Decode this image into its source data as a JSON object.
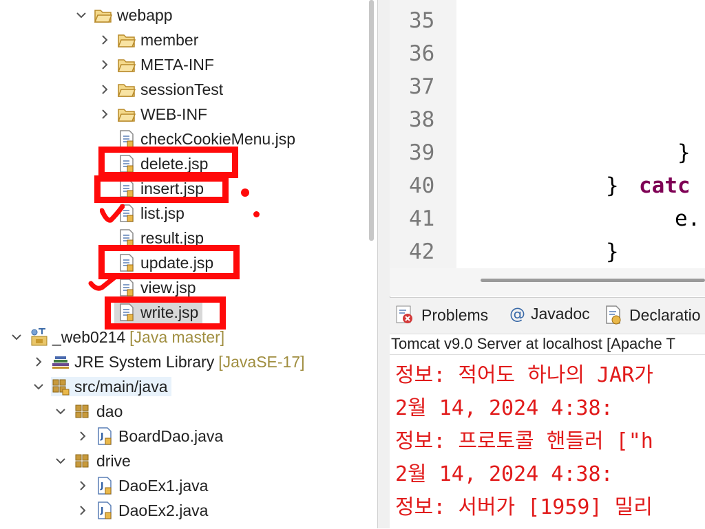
{
  "explorer": {
    "items": [
      {
        "label": "webapp",
        "kind": "folder",
        "expanded": true
      },
      {
        "label": "member",
        "kind": "folder",
        "expanded": false
      },
      {
        "label": "META-INF",
        "kind": "folder",
        "expanded": false
      },
      {
        "label": "sessionTest",
        "kind": "folder",
        "expanded": false
      },
      {
        "label": "WEB-INF",
        "kind": "folder",
        "expanded": false
      },
      {
        "label": "checkCookieMenu.jsp",
        "kind": "jsp"
      },
      {
        "label": "delete.jsp",
        "kind": "jsp"
      },
      {
        "label": "insert.jsp",
        "kind": "jsp"
      },
      {
        "label": "list.jsp",
        "kind": "jsp"
      },
      {
        "label": "result.jsp",
        "kind": "jsp"
      },
      {
        "label": "update.jsp",
        "kind": "jsp"
      },
      {
        "label": "view.jsp",
        "kind": "jsp"
      },
      {
        "label": "write.jsp",
        "kind": "jsp",
        "selected": true
      },
      {
        "label": "_web0214",
        "decorator": "[Java master]",
        "kind": "project",
        "expanded": true
      },
      {
        "label": "JRE System Library",
        "decorator": "[JavaSE-17]",
        "kind": "library",
        "expanded": false
      },
      {
        "label": "src/main/java",
        "kind": "source-folder",
        "expanded": true
      },
      {
        "label": "dao",
        "kind": "package",
        "expanded": true
      },
      {
        "label": "BoardDao.java",
        "kind": "java",
        "expanded": false
      },
      {
        "label": "drive",
        "kind": "package",
        "expanded": true
      },
      {
        "label": "DaoEx1.java",
        "kind": "java",
        "expanded": false
      },
      {
        "label": "DaoEx2.java",
        "kind": "java",
        "expanded": false
      }
    ]
  },
  "editor": {
    "line_numbers": [
      "35",
      "36",
      "37",
      "38",
      "39",
      "40",
      "41",
      "42"
    ],
    "code": {
      "l39": "}",
      "l40_brace": "}",
      "l40_kw": "catc",
      "l41": "e.",
      "l42": "}"
    }
  },
  "panel": {
    "tabs": [
      {
        "label": "Problems",
        "icon": "problems-icon"
      },
      {
        "label": "Javadoc",
        "icon": "javadoc-icon"
      },
      {
        "label": "Declaratio",
        "icon": "declaration-icon"
      }
    ],
    "console_title": "Tomcat v9.0 Server at localhost [Apache T",
    "console_lines": [
      "정보: 적어도 하나의 JAR가",
      "2월 14, 2024 4:38:",
      "정보: 프로토콜 핸들러 [\"h",
      "2월 14, 2024 4:38:",
      "정보: 서버가 [1959] 밀리"
    ]
  },
  "colors": {
    "keyword": "#7f0055",
    "console_error": "#e11b1b",
    "annotation": "#ff0a0a",
    "line_number": "#787878"
  }
}
